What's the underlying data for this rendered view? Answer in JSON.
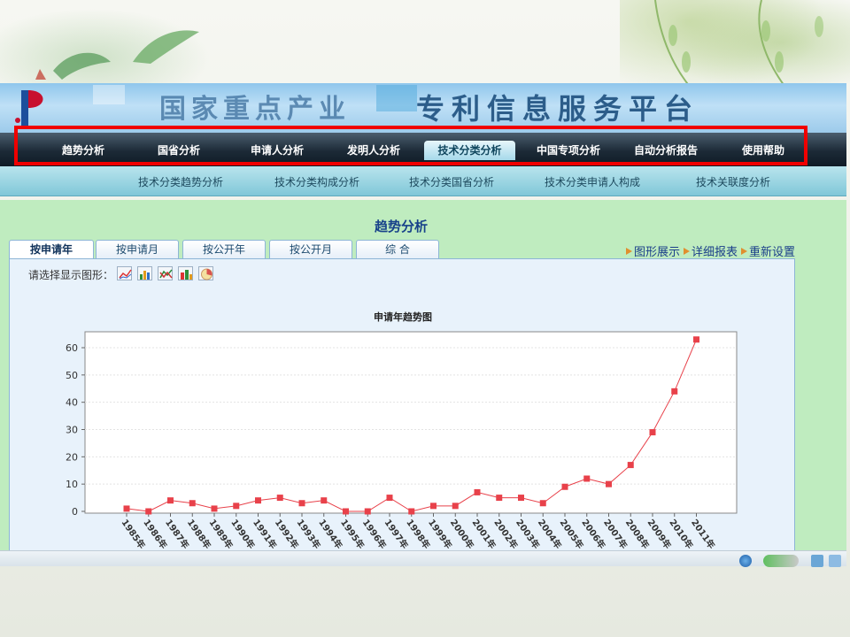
{
  "banner": {
    "title_left": "国家重点产业",
    "title_right": "专利信息服务平台"
  },
  "nav": {
    "items": [
      {
        "label": "趋势分析"
      },
      {
        "label": "国省分析"
      },
      {
        "label": "申请人分析"
      },
      {
        "label": "发明人分析"
      },
      {
        "label": "技术分类分析",
        "active": true
      },
      {
        "label": "中国专项分析"
      },
      {
        "label": "自动分析报告"
      },
      {
        "label": "使用帮助"
      }
    ]
  },
  "sub_nav": {
    "items": [
      {
        "label": "技术分类趋势分析"
      },
      {
        "label": "技术分类构成分析"
      },
      {
        "label": "技术分类国省分析"
      },
      {
        "label": "技术分类申请人构成"
      },
      {
        "label": "技术关联度分析"
      }
    ]
  },
  "page": {
    "title": "趋势分析",
    "tabs": [
      {
        "label": "按申请年",
        "active": true
      },
      {
        "label": "按申请月"
      },
      {
        "label": "按公开年"
      },
      {
        "label": "按公开月"
      },
      {
        "label": "综 合"
      }
    ],
    "links": [
      {
        "label": "图形展示"
      },
      {
        "label": "详细报表"
      },
      {
        "label": "重新设置"
      }
    ],
    "chart_select_label": "请选择显示图形：",
    "chart_type_icons": [
      "line-chart-icon",
      "bar-chart-icon",
      "area-chart-icon",
      "stacked-bar-icon",
      "pie-chart-icon"
    ]
  },
  "chart_data": {
    "type": "line",
    "title": "申请年趋势图",
    "xlabel": "",
    "ylabel": "",
    "x": [
      "1985年",
      "1986年",
      "1987年",
      "1988年",
      "1989年",
      "1990年",
      "1991年",
      "1992年",
      "1993年",
      "1994年",
      "1995年",
      "1996年",
      "1997年",
      "1998年",
      "1999年",
      "2000年",
      "2001年",
      "2002年",
      "2003年",
      "2004年",
      "2005年",
      "2006年",
      "2007年",
      "2008年",
      "2009年",
      "2010年",
      "2011年"
    ],
    "values": [
      1,
      0,
      4,
      3,
      1,
      2,
      4,
      5,
      3,
      4,
      0,
      0,
      5,
      0,
      2,
      2,
      7,
      5,
      5,
      3,
      9,
      12,
      10,
      17,
      29,
      44,
      63
    ],
    "ylim": [
      0,
      66
    ],
    "yticks": [
      0,
      10,
      20,
      30,
      40,
      50,
      60
    ],
    "grid": true,
    "color": "#e8414a"
  }
}
